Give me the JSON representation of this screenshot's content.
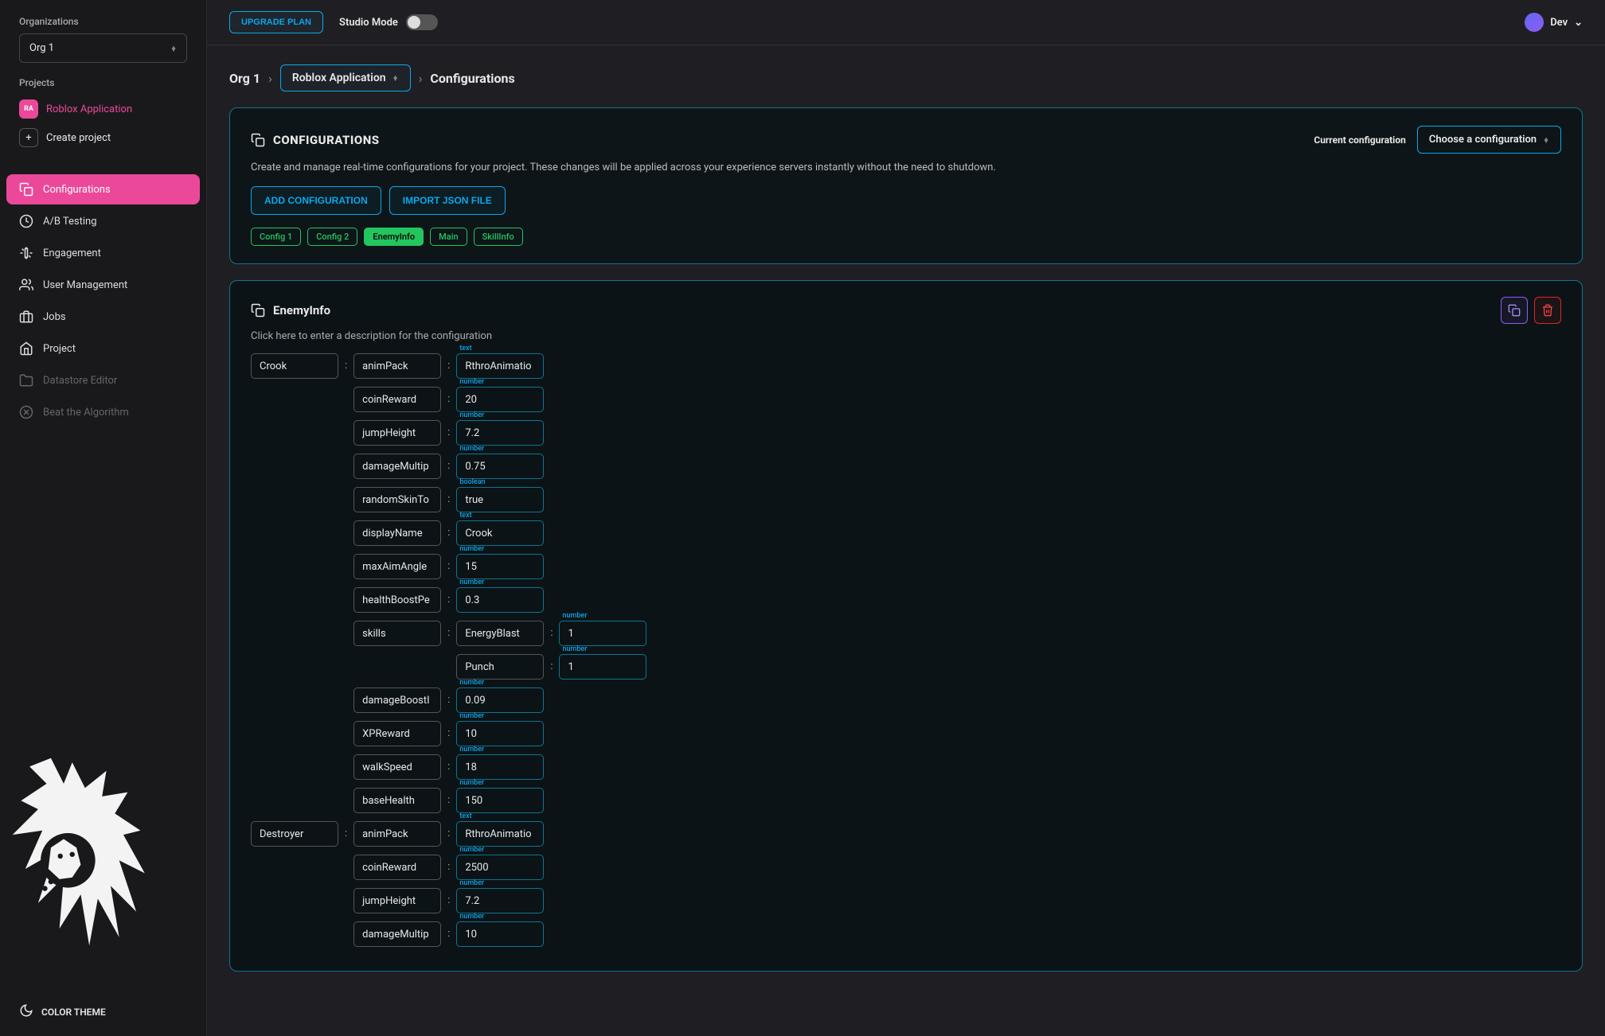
{
  "sidebar": {
    "org_label": "Organizations",
    "org_selected": "Org 1",
    "projects_label": "Projects",
    "projects": [
      {
        "avatar": "RA",
        "name": "Roblox Application",
        "active": true
      }
    ],
    "create_label": "Create project",
    "nav": [
      {
        "icon": "configurations",
        "label": "Configurations",
        "active": true
      },
      {
        "icon": "abtesting",
        "label": "A/B Testing"
      },
      {
        "icon": "engagement",
        "label": "Engagement"
      },
      {
        "icon": "users",
        "label": "User Management"
      },
      {
        "icon": "jobs",
        "label": "Jobs"
      },
      {
        "icon": "project",
        "label": "Project"
      },
      {
        "icon": "datastore",
        "label": "Datastore Editor",
        "disabled": true
      },
      {
        "icon": "algorithm",
        "label": "Beat the Algorithm",
        "disabled": true
      }
    ],
    "theme_label": "COLOR THEME"
  },
  "topbar": {
    "upgrade": "UPGRADE PLAN",
    "studio_mode": "Studio Mode",
    "user": "Dev"
  },
  "breadcrumb": {
    "org": "Org 1",
    "app": "Roblox Application",
    "page": "Configurations"
  },
  "panel": {
    "title": "CONFIGURATIONS",
    "desc": "Create and manage real-time configurations for your project. These changes will be applied across your experience servers instantly without the need to shutdown.",
    "current_label": "Current configuration",
    "choose": "Choose a configuration",
    "add_btn": "ADD CONFIGURATION",
    "import_btn": "IMPORT JSON FILE",
    "tabs": [
      "Config 1",
      "Config 2",
      "EnemyInfo",
      "Main",
      "SkillInfo"
    ],
    "active_tab": "EnemyInfo"
  },
  "config": {
    "name": "EnemyInfo",
    "desc_placeholder": "Click here to enter a description for the configuration",
    "entities": [
      {
        "key": "Crook",
        "props": [
          {
            "k": "animPack",
            "type": "text",
            "v": "RthroAnimatio"
          },
          {
            "k": "coinReward",
            "type": "number",
            "v": "20"
          },
          {
            "k": "jumpHeight",
            "type": "number",
            "v": "7.2"
          },
          {
            "k": "damageMultip",
            "type": "number",
            "v": "0.75"
          },
          {
            "k": "randomSkinTo",
            "type": "boolean",
            "v": "true"
          },
          {
            "k": "displayName",
            "type": "text",
            "v": "Crook"
          },
          {
            "k": "maxAimAngle",
            "type": "number",
            "v": "15"
          },
          {
            "k": "healthBoostPe",
            "type": "number",
            "v": "0.3"
          },
          {
            "k": "skills",
            "nested": [
              {
                "k": "EnergyBlast",
                "type": "number",
                "v": "1"
              },
              {
                "k": "Punch",
                "type": "number",
                "v": "1"
              }
            ]
          },
          {
            "k": "damageBoostI",
            "type": "number",
            "v": "0.09"
          },
          {
            "k": "XPReward",
            "type": "number",
            "v": "10"
          },
          {
            "k": "walkSpeed",
            "type": "number",
            "v": "18"
          },
          {
            "k": "baseHealth",
            "type": "number",
            "v": "150"
          }
        ]
      },
      {
        "key": "Destroyer",
        "props": [
          {
            "k": "animPack",
            "type": "text",
            "v": "RthroAnimatio"
          },
          {
            "k": "coinReward",
            "type": "number",
            "v": "2500"
          },
          {
            "k": "jumpHeight",
            "type": "number",
            "v": "7.2"
          },
          {
            "k": "damageMultip",
            "type": "number",
            "v": "10"
          }
        ]
      }
    ]
  }
}
